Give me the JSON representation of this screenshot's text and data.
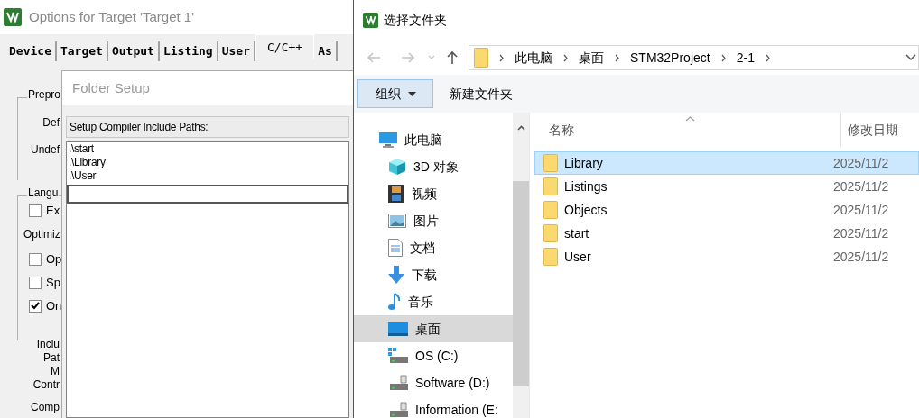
{
  "options_window": {
    "title": "Options for Target 'Target 1'",
    "tabs": [
      {
        "label": "Device",
        "selected": false
      },
      {
        "label": "Target",
        "selected": false
      },
      {
        "label": "Output",
        "selected": false
      },
      {
        "label": "Listing",
        "selected": false
      },
      {
        "label": "User",
        "selected": false
      },
      {
        "label": "C/C++",
        "selected": true
      },
      {
        "label": "As",
        "selected": false
      }
    ],
    "items": [
      {
        "kind": "group",
        "label": "Prepro"
      },
      {
        "kind": "label",
        "label": "Def"
      },
      {
        "kind": "label",
        "label": "Undef"
      },
      {
        "kind": "group",
        "label": "Langu"
      },
      {
        "kind": "checkbox",
        "label": "Ex",
        "checked": false
      },
      {
        "kind": "text",
        "label": "Optimiz"
      },
      {
        "kind": "checkbox",
        "label": "Op",
        "checked": false
      },
      {
        "kind": "checkbox",
        "label": "Sp",
        "checked": false
      },
      {
        "kind": "checkbox",
        "label": "On",
        "checked": true
      },
      {
        "kind": "label",
        "label": "Inclu"
      },
      {
        "kind": "label",
        "label": "Pat"
      },
      {
        "kind": "label",
        "label": "M"
      },
      {
        "kind": "label",
        "label": "Contr"
      },
      {
        "kind": "label",
        "label": "Comp"
      }
    ]
  },
  "folder_setup": {
    "title": "Folder Setup",
    "header": "Setup Compiler Include Paths:",
    "paths": [
      ".\\start",
      ".\\Library",
      ".\\User"
    ]
  },
  "explorer": {
    "title": "选择文件夹",
    "breadcrumb": [
      "此电脑",
      "桌面",
      "STM32Project",
      "2-1"
    ],
    "toolbar": {
      "organize": "组织",
      "new_folder": "新建文件夹"
    },
    "nav_items": [
      {
        "label": "此电脑",
        "kind": "pc",
        "selected": false
      },
      {
        "label": "3D 对象",
        "kind": "cube",
        "selected": false
      },
      {
        "label": "视频",
        "kind": "video",
        "selected": false
      },
      {
        "label": "图片",
        "kind": "picture",
        "selected": false
      },
      {
        "label": "文档",
        "kind": "document",
        "selected": false
      },
      {
        "label": "下载",
        "kind": "download",
        "selected": false
      },
      {
        "label": "音乐",
        "kind": "music",
        "selected": false
      },
      {
        "label": "桌面",
        "kind": "desktop",
        "selected": true
      },
      {
        "label": "OS (C:)",
        "kind": "os_drive",
        "selected": false
      },
      {
        "label": "Software (D:)",
        "kind": "drive",
        "selected": false
      },
      {
        "label": "Information (E:",
        "kind": "drive",
        "selected": false
      }
    ],
    "columns": [
      "名称",
      "修改日期"
    ],
    "files": [
      {
        "name": "Library",
        "date": "2025/11/2",
        "selected": true
      },
      {
        "name": "Listings",
        "date": "2025/11/2",
        "selected": false
      },
      {
        "name": "Objects",
        "date": "2025/11/2",
        "selected": false
      },
      {
        "name": "start",
        "date": "2025/11/2",
        "selected": false
      },
      {
        "name": "User",
        "date": "2025/11/2",
        "selected": false
      }
    ]
  }
}
